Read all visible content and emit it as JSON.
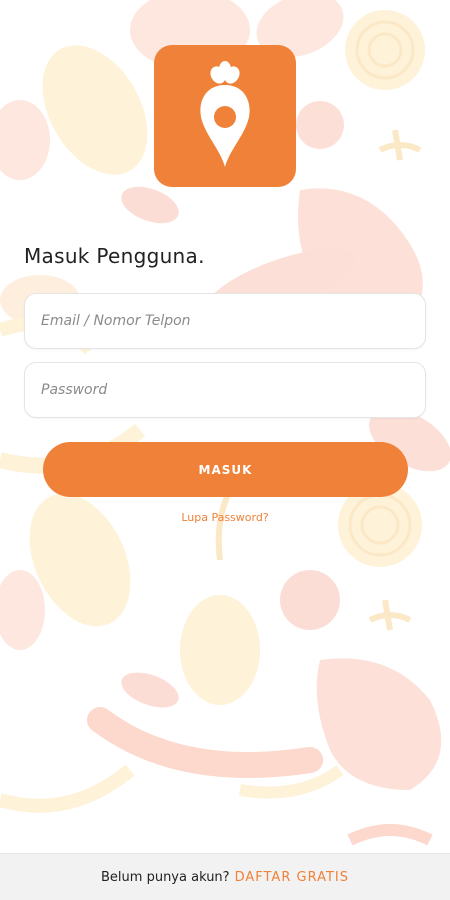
{
  "app": {
    "brand_color": "#ef8138",
    "logo_icon": "carrot-location-pin-icon"
  },
  "login": {
    "title": "Masuk Pengguna.",
    "email_placeholder": "Email / Nomor Telpon",
    "password_placeholder": "Password",
    "submit_label": "MASUK",
    "forgot_password_link": "Lupa Password?"
  },
  "footer": {
    "prompt": "Belum punya akun?",
    "signup_link": "DAFTAR GRATIS"
  }
}
